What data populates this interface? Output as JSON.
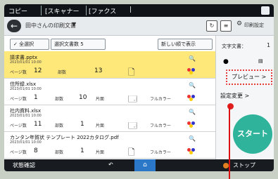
{
  "statusbar": {
    "tab1": "コピー",
    "tab2": "[スキャナー",
    "tab3": "[ファクス",
    "tab4": "|"
  },
  "title": {
    "text": "田中さんの印刷文書",
    "caret": "▼",
    "settings": "印刷設定"
  },
  "toolbar": {
    "select_all": "全選択",
    "selected": "選択文書数 5",
    "sort": "新しい順で表示"
  },
  "panel": {
    "total_label": "文字文書：",
    "total_value": "1",
    "preview": "プレビュー >",
    "detail": "設定変更 >",
    "start": "スタート"
  },
  "files": [
    {
      "name": "請求書.pptx",
      "date": "2023/01/01 10:00",
      "copies_label": "ページ数",
      "copies": "12",
      "sets_label": "部数",
      "sets": "13",
      "mode": "両面",
      "layout": "",
      "selected": true
    },
    {
      "name": "住所録.xlsx",
      "date": "2023/01/01 10:00",
      "copies_label": "ページ数",
      "copies": "1",
      "sets_label": "部数",
      "sets": "10",
      "mode": "片面",
      "layout": "フルカラー",
      "selected": false
    },
    {
      "name": "社内資料.xlsx",
      "date": "2023/01/01 10:00",
      "copies_label": "ページ数",
      "copies": "11",
      "sets_label": "部数",
      "sets": "1",
      "mode": "片面",
      "layout": "フルカラー",
      "selected": false
    },
    {
      "name": "カンタン年賀状 テンプレート 2022カタログ.pdf",
      "date": "2023/01/01 10:00",
      "copies_label": "ページ数",
      "copies": "8",
      "sets_label": "部数",
      "sets": "1",
      "mode": "片面",
      "layout": "フルカラー",
      "selected": false
    }
  ],
  "bottombar": {
    "status": "状態確認",
    "back": "↶",
    "home": "⌂",
    "stop": "ストップ"
  },
  "colors": {
    "accent": "#2fb39a",
    "selected_row": "#ffe87a",
    "highlight": "#e63a3a"
  }
}
